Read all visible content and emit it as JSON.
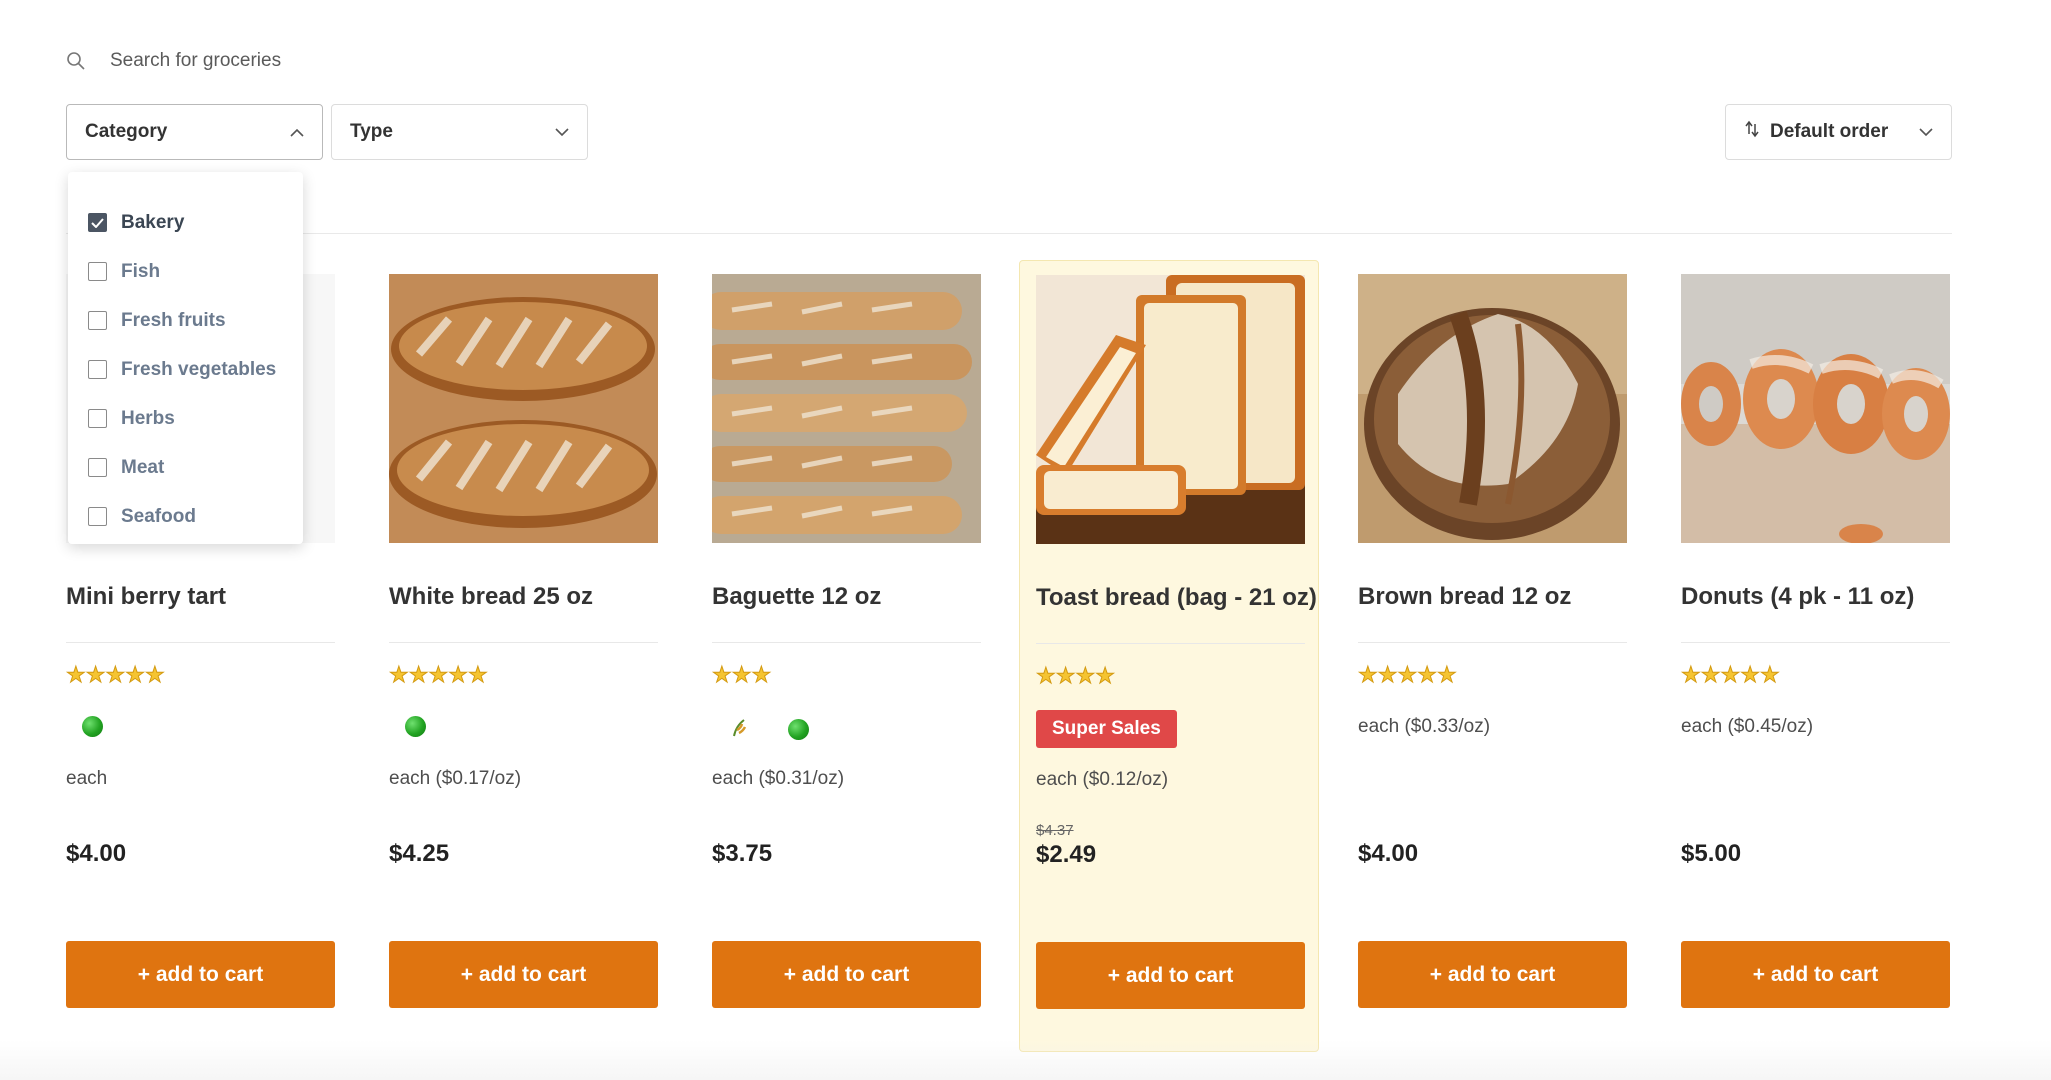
{
  "search": {
    "placeholder": "Search for groceries"
  },
  "filters": {
    "category_label": "Category",
    "type_label": "Type",
    "order_label": "Default order"
  },
  "category_options": [
    {
      "label": "Bakery",
      "checked": true
    },
    {
      "label": "Fish",
      "checked": false
    },
    {
      "label": "Fresh fruits",
      "checked": false
    },
    {
      "label": "Fresh vegetables",
      "checked": false
    },
    {
      "label": "Herbs",
      "checked": false
    },
    {
      "label": "Meat",
      "checked": false
    },
    {
      "label": "Seafood",
      "checked": false
    }
  ],
  "colors": {
    "accent": "#df7410",
    "highlight_bg": "#fef8df",
    "sale_badge": "#e04848"
  },
  "products": [
    {
      "title": "Mini berry tart",
      "stars": 5,
      "icons": [
        "organic-dot-icon"
      ],
      "unit": "each",
      "price": "$4.00",
      "cart": "+ add to cart"
    },
    {
      "title": "White bread 25 oz",
      "stars": 5,
      "icons": [
        "organic-dot-icon"
      ],
      "unit": "each ($0.17/oz)",
      "price": "$4.25",
      "cart": "+ add to cart"
    },
    {
      "title": "Baguette 12 oz",
      "stars": 3,
      "icons": [
        "wheat-icon",
        "organic-dot-icon"
      ],
      "unit": "each ($0.31/oz)",
      "price": "$3.75",
      "cart": "+ add to cart"
    },
    {
      "title": "Toast bread (bag - 21 oz)",
      "stars": 4,
      "badge": "Super Sales",
      "unit": "each ($0.12/oz)",
      "old_price": "$4.37",
      "price": "$2.49",
      "cart": "+ add to cart"
    },
    {
      "title": "Brown bread 12 oz",
      "stars": 5,
      "unit": "each ($0.33/oz)",
      "price": "$4.00",
      "cart": "+ add to cart"
    },
    {
      "title": "Donuts (4 pk - 11 oz)",
      "stars": 5,
      "unit": "each ($0.45/oz)",
      "price": "$5.00",
      "cart": "+ add to cart"
    }
  ]
}
